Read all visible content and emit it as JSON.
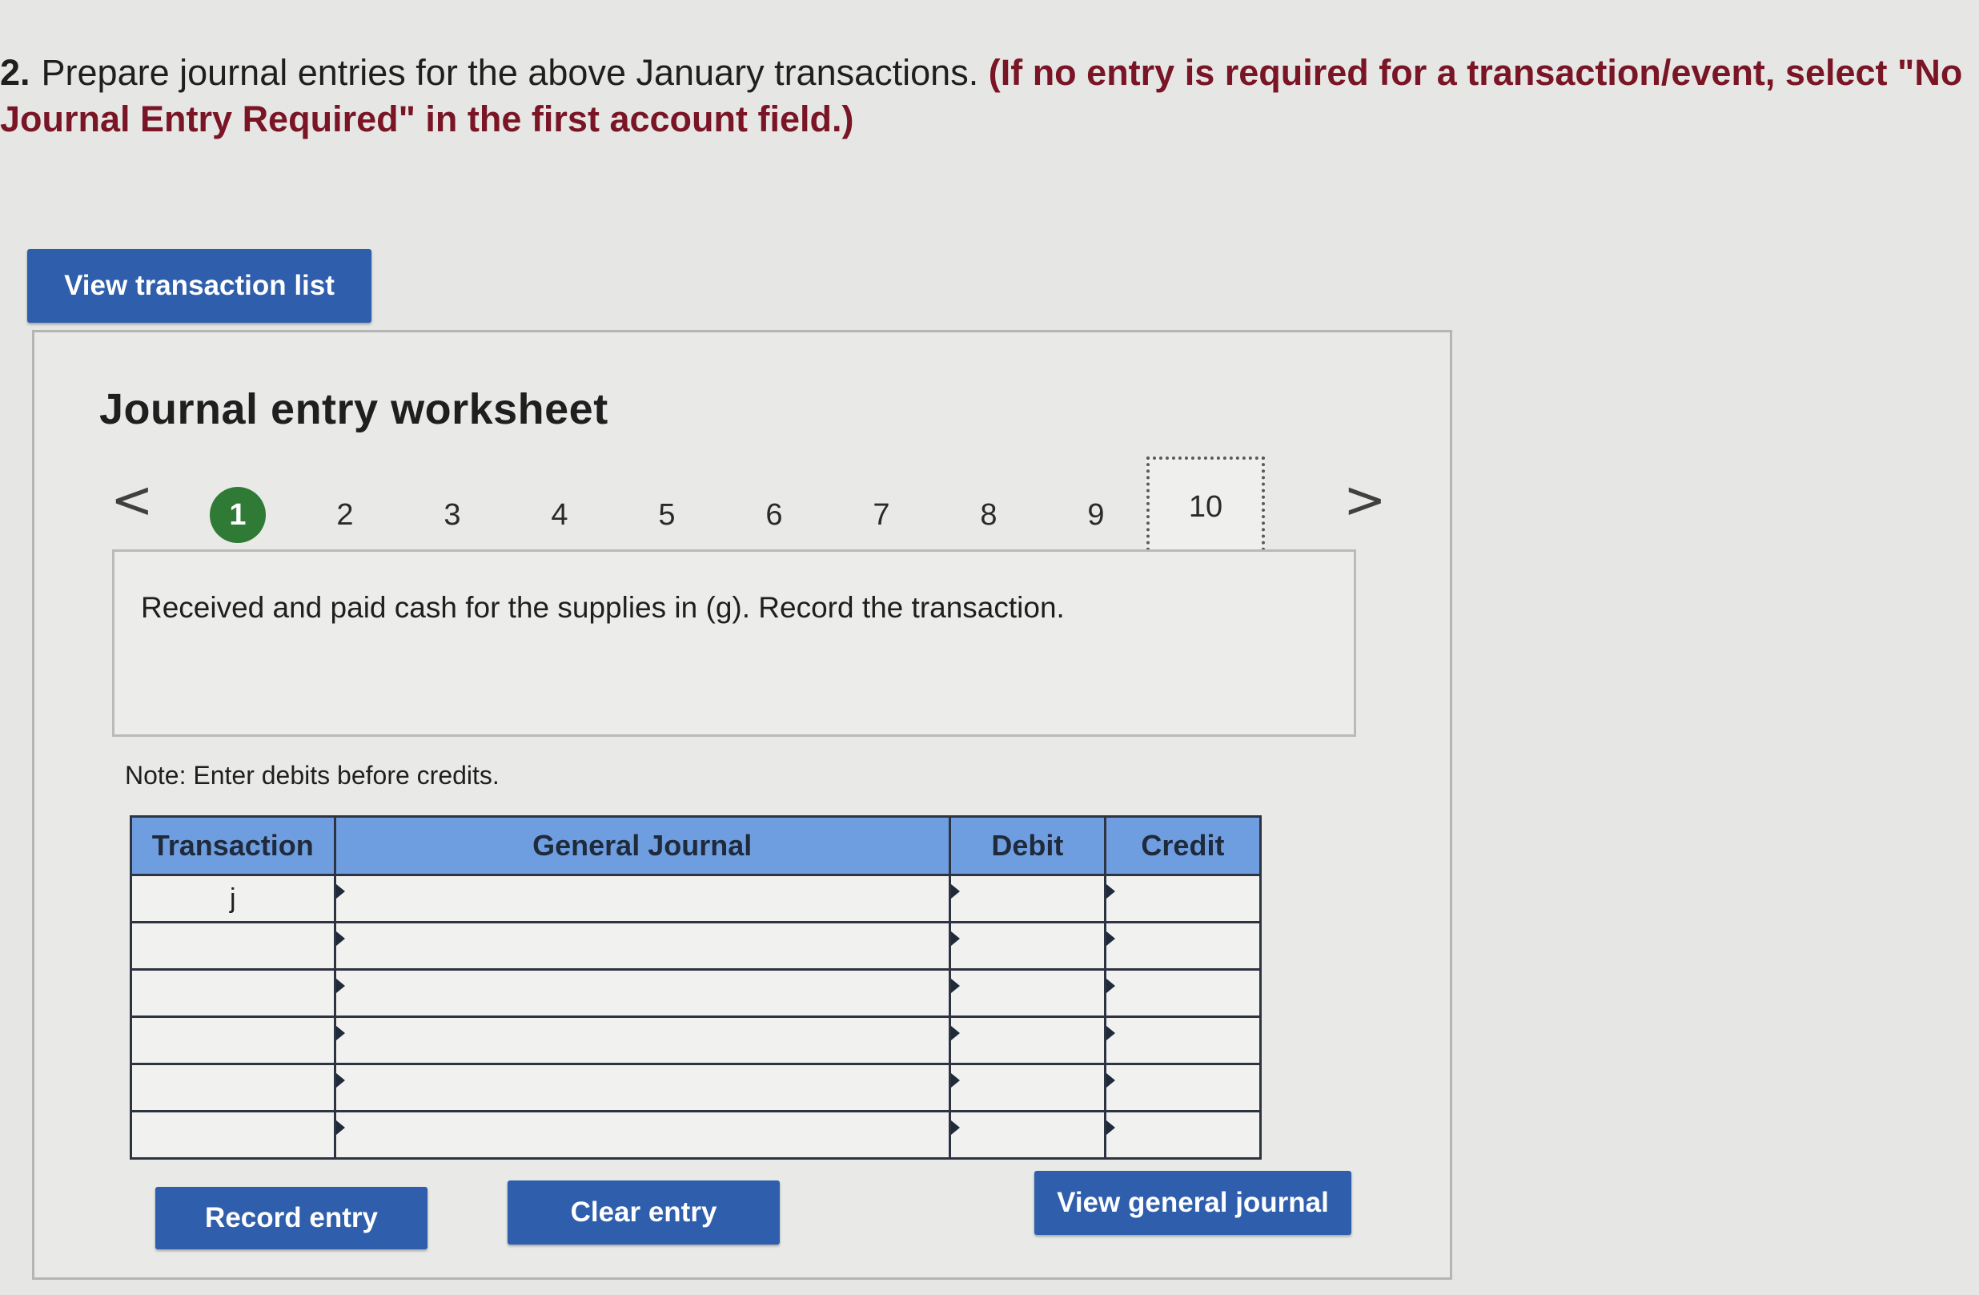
{
  "question": {
    "number": "2.",
    "text": "Prepare journal entries for the above January transactions.",
    "emphasis": "(If no entry is required for a transaction/event, select \"No Journal Entry Required\" in the first account field.)"
  },
  "buttons": {
    "view_transaction_list": "View transaction list",
    "record_entry": "Record entry",
    "clear_entry": "Clear entry",
    "view_general_journal": "View general journal"
  },
  "worksheet": {
    "title": "Journal entry worksheet",
    "prev_arrow": "<",
    "next_arrow": ">",
    "steps": [
      "1",
      "2",
      "3",
      "4",
      "5",
      "6",
      "7",
      "8",
      "9",
      "10"
    ],
    "active_step": "1",
    "description": "Received and paid cash for the supplies in (g). Record the transaction.",
    "note": "Note: Enter debits before credits."
  },
  "journal": {
    "headers": [
      "Transaction",
      "General Journal",
      "Debit",
      "Credit"
    ],
    "rows": [
      {
        "transaction": "j",
        "account": "",
        "debit": "",
        "credit": ""
      },
      {
        "transaction": "",
        "account": "",
        "debit": "",
        "credit": ""
      },
      {
        "transaction": "",
        "account": "",
        "debit": "",
        "credit": ""
      },
      {
        "transaction": "",
        "account": "",
        "debit": "",
        "credit": ""
      },
      {
        "transaction": "",
        "account": "",
        "debit": "",
        "credit": ""
      },
      {
        "transaction": "",
        "account": "",
        "debit": "",
        "credit": ""
      }
    ]
  },
  "colors": {
    "button_blue": "#2f5eac",
    "header_blue": "#6f9ee0",
    "active_step_green": "#2f7a34",
    "emphasis_red": "#7a1526"
  }
}
